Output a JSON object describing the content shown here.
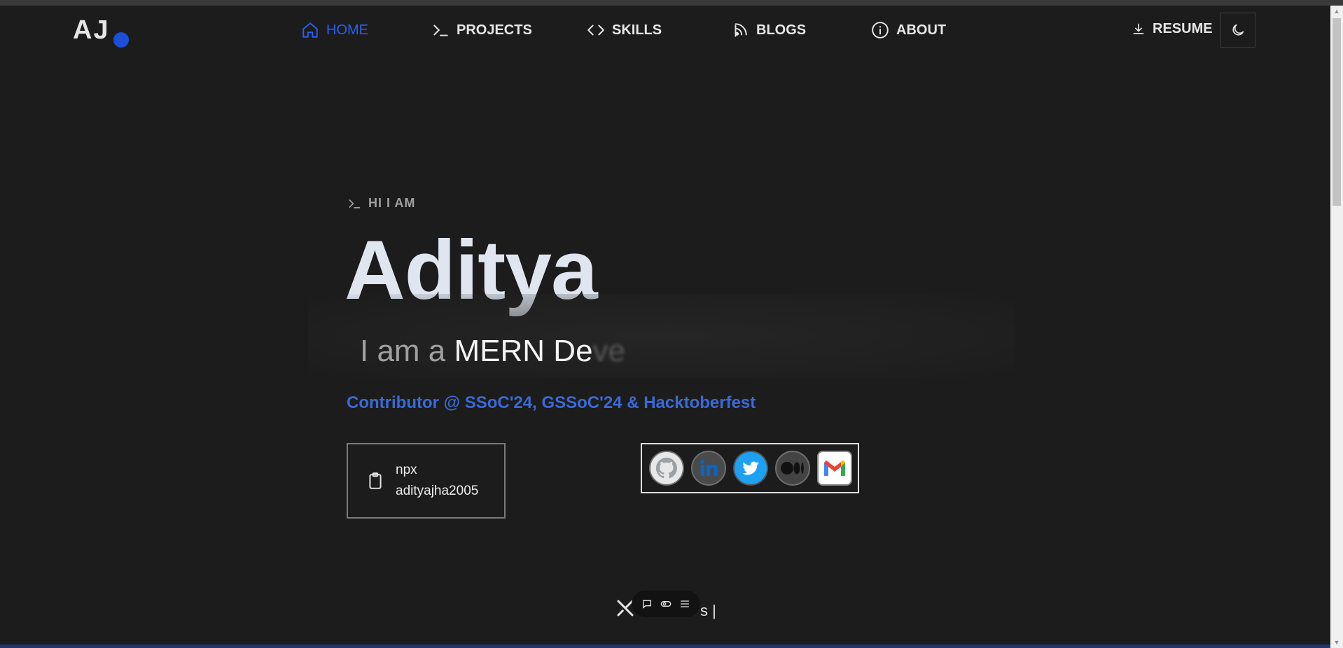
{
  "logo": {
    "text": "AJ"
  },
  "nav": {
    "items": [
      {
        "label": "HOME",
        "icon": "home-icon",
        "active": true
      },
      {
        "label": "PROJECTS",
        "icon": "terminal-icon"
      },
      {
        "label": "SKILLS",
        "icon": "code-icon"
      },
      {
        "label": "BLOGS",
        "icon": "blog-icon"
      },
      {
        "label": "ABOUT",
        "icon": "info-icon"
      }
    ],
    "resume_label": "RESUME"
  },
  "hero": {
    "greeting": "HI I AM",
    "name": "Aditya",
    "typing_prefix": "I am a",
    "typing_text": "MERN De",
    "typing_fading": "ve",
    "contributor": "Contributor @ SSoC'24, GSSoC'24 & Hacktoberfest",
    "npx_line1": "npx",
    "npx_line2": "adityajha2005"
  },
  "social": [
    {
      "name": "github",
      "icon": "github-icon"
    },
    {
      "name": "linkedin",
      "icon": "linkedin-icon"
    },
    {
      "name": "twitter",
      "icon": "twitter-icon"
    },
    {
      "name": "medium",
      "icon": "medium-icon"
    },
    {
      "name": "gmail",
      "icon": "gmail-icon"
    }
  ],
  "bottom": {
    "text": "s |"
  },
  "colors": {
    "accent": "#2b5ff0",
    "background": "#1c1c1c",
    "contributor": "#3a6ad6"
  }
}
